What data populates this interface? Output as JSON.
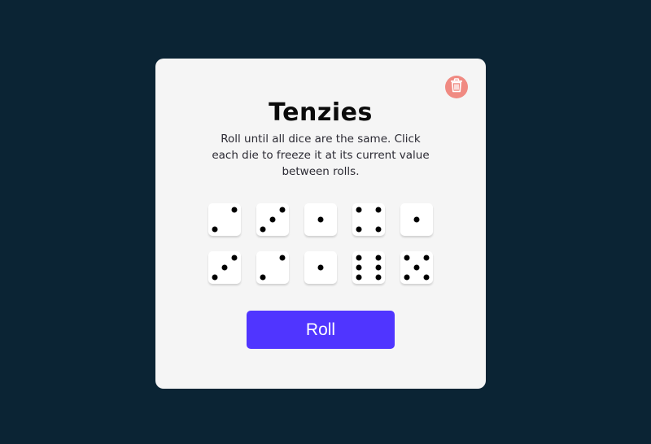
{
  "game": {
    "title": "Tenzies",
    "instructions": "Roll until all dice are the same. Click each die to freeze it at its current value between rolls.",
    "roll_label": "Roll",
    "reset_icon": "trash-icon"
  },
  "dice": [
    {
      "value": 2,
      "held": false
    },
    {
      "value": 3,
      "held": false
    },
    {
      "value": 1,
      "held": false
    },
    {
      "value": 4,
      "held": false
    },
    {
      "value": 1,
      "held": false
    },
    {
      "value": 3,
      "held": false
    },
    {
      "value": 2,
      "held": false
    },
    {
      "value": 1,
      "held": false
    },
    {
      "value": 6,
      "held": false
    },
    {
      "value": 5,
      "held": false
    }
  ],
  "colors": {
    "background": "#0b2434",
    "card": "#f5f5f5",
    "accent": "#5035ff",
    "reset": "#f08a82",
    "held": "#59e391"
  }
}
